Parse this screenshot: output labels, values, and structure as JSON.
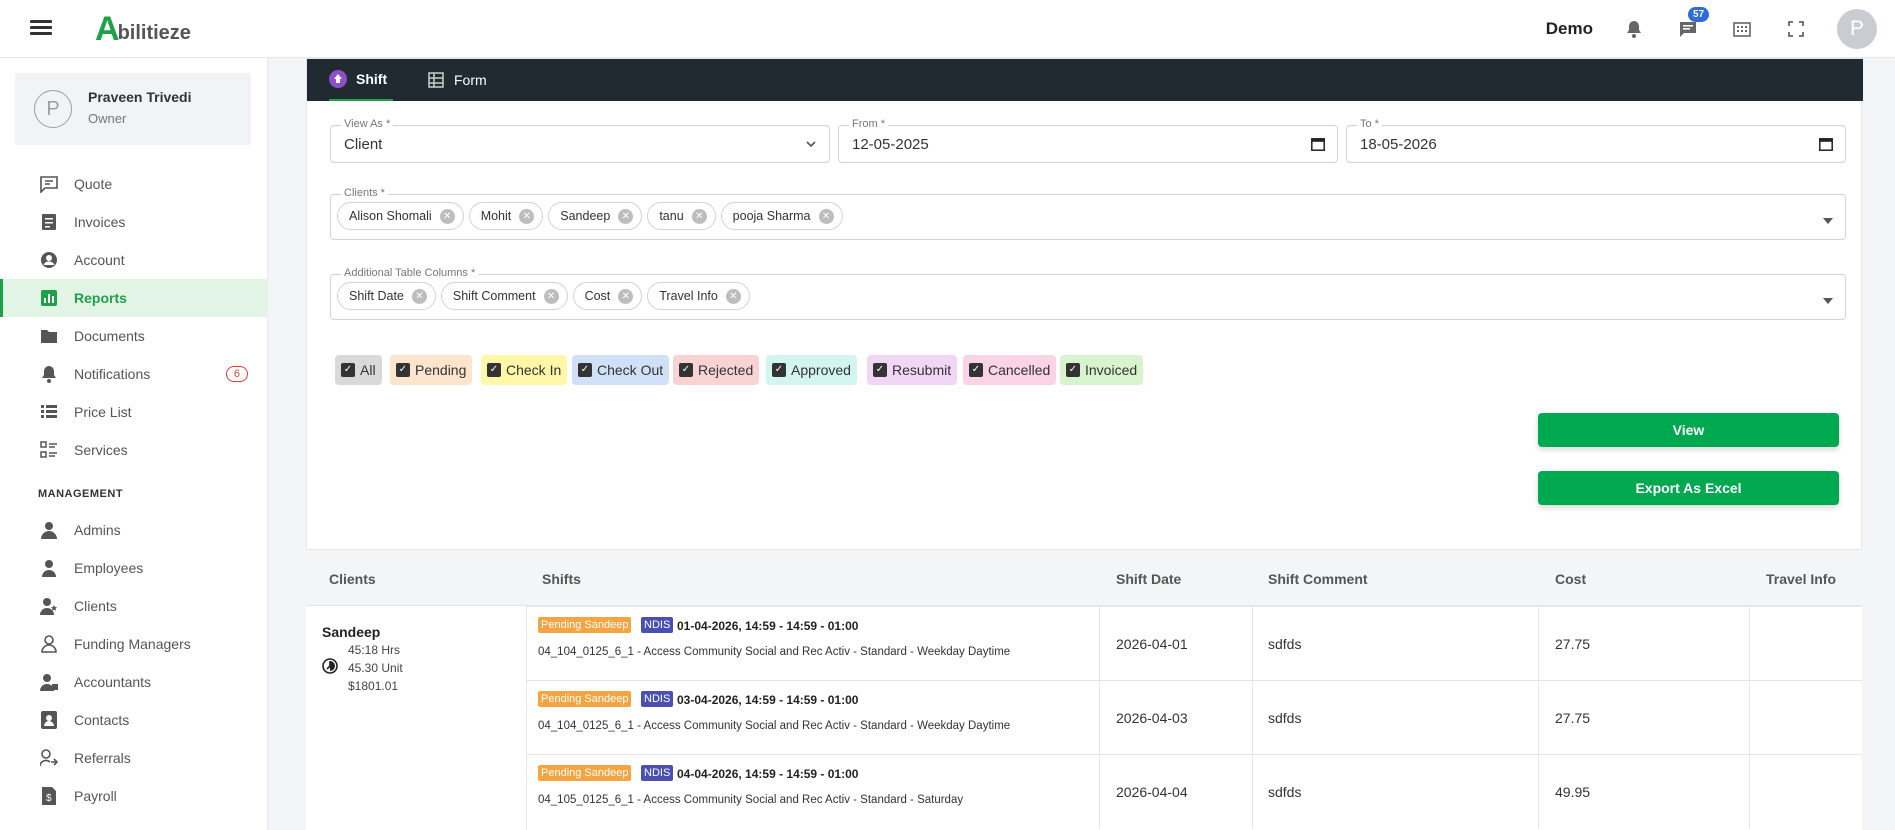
{
  "header": {
    "logo_a": "A",
    "logo_rest": "bilitieze",
    "demo": "Demo",
    "chat_badge": "57",
    "avatar": "P"
  },
  "sidebar": {
    "user": {
      "initial": "P",
      "name": "Praveen Trivedi",
      "role": "Owner"
    },
    "items": [
      {
        "label": "Quote",
        "icon": "quote-icon"
      },
      {
        "label": "Invoices",
        "icon": "invoice-icon"
      },
      {
        "label": "Account",
        "icon": "account-icon"
      },
      {
        "label": "Reports",
        "icon": "reports-icon",
        "active": true
      },
      {
        "label": "Documents",
        "icon": "folder-icon"
      },
      {
        "label": "Notifications",
        "icon": "bell-icon",
        "badge": "6"
      },
      {
        "label": "Price List",
        "icon": "list-icon"
      },
      {
        "label": "Services",
        "icon": "services-icon"
      }
    ],
    "section": "MANAGEMENT",
    "management": [
      {
        "label": "Admins",
        "icon": "admin-icon"
      },
      {
        "label": "Employees",
        "icon": "employee-icon"
      },
      {
        "label": "Clients",
        "icon": "client-icon"
      },
      {
        "label": "Funding Managers",
        "icon": "funding-icon"
      },
      {
        "label": "Accountants",
        "icon": "accountant-icon"
      },
      {
        "label": "Contacts",
        "icon": "contacts-icon"
      },
      {
        "label": "Referrals",
        "icon": "referral-icon"
      },
      {
        "label": "Payroll",
        "icon": "payroll-icon"
      }
    ]
  },
  "tabs": [
    {
      "label": "Shift",
      "active": true
    },
    {
      "label": "Form"
    }
  ],
  "form": {
    "view_as": {
      "label": "View As *",
      "value": "Client"
    },
    "from": {
      "label": "From *",
      "value": "12-05-2025"
    },
    "to": {
      "label": "To *",
      "value": "18-05-2026"
    },
    "clients": {
      "label": "Clients *",
      "chips": [
        "Alison Shomali",
        "Mohit",
        "Sandeep",
        "tanu",
        "pooja Sharma"
      ]
    },
    "columns": {
      "label": "Additional Table Columns *",
      "chips": [
        "Shift Date",
        "Shift Comment",
        "Cost",
        "Travel Info"
      ]
    },
    "statuses": [
      {
        "label": "All",
        "color": "#d9d9d9"
      },
      {
        "label": "Pending",
        "color": "#fde4cc"
      },
      {
        "label": "Check In",
        "color": "#fff7a8"
      },
      {
        "label": "Check Out",
        "color": "#cfe0f7"
      },
      {
        "label": "Rejected",
        "color": "#f8d3d3"
      },
      {
        "label": "Approved",
        "color": "#d2f5f0"
      },
      {
        "label": "Resubmit",
        "color": "#f1d6f5"
      },
      {
        "label": "Cancelled",
        "color": "#fbd3e6"
      },
      {
        "label": "Invoiced",
        "color": "#d8f4cf"
      }
    ],
    "view_btn": "View",
    "export_btn": "Export As Excel"
  },
  "table": {
    "headers": [
      "Clients",
      "Shifts",
      "Shift Date",
      "Shift Comment",
      "Cost",
      "Travel Info"
    ],
    "client": {
      "name": "Sandeep",
      "hrs": "45:18 Hrs",
      "unit": "45.30 Unit",
      "amount": "$1801.01"
    },
    "rows": [
      {
        "tag": "Pending Sandeep",
        "ndis": "NDIS",
        "datetime": "01-04-2026,  14:59 - 14:59 - 01:00",
        "desc": "04_104_0125_6_1 - Access Community Social and Rec Activ - Standard - Weekday Daytime",
        "date": "2026-04-01",
        "comment": "sdfds",
        "cost": "27.75"
      },
      {
        "tag": "Pending Sandeep",
        "ndis": "NDIS",
        "datetime": "03-04-2026,  14:59 - 14:59 - 01:00",
        "desc": "04_104_0125_6_1 - Access Community Social and Rec Activ - Standard - Weekday Daytime",
        "date": "2026-04-03",
        "comment": "sdfds",
        "cost": "27.75"
      },
      {
        "tag": "Pending Sandeep",
        "ndis": "NDIS",
        "datetime": "04-04-2026,  14:59 - 14:59 - 01:00",
        "desc": "04_105_0125_6_1 - Access Community Social and Rec Activ - Standard - Saturday",
        "date": "2026-04-04",
        "comment": "sdfds",
        "cost": "49.95"
      }
    ]
  }
}
